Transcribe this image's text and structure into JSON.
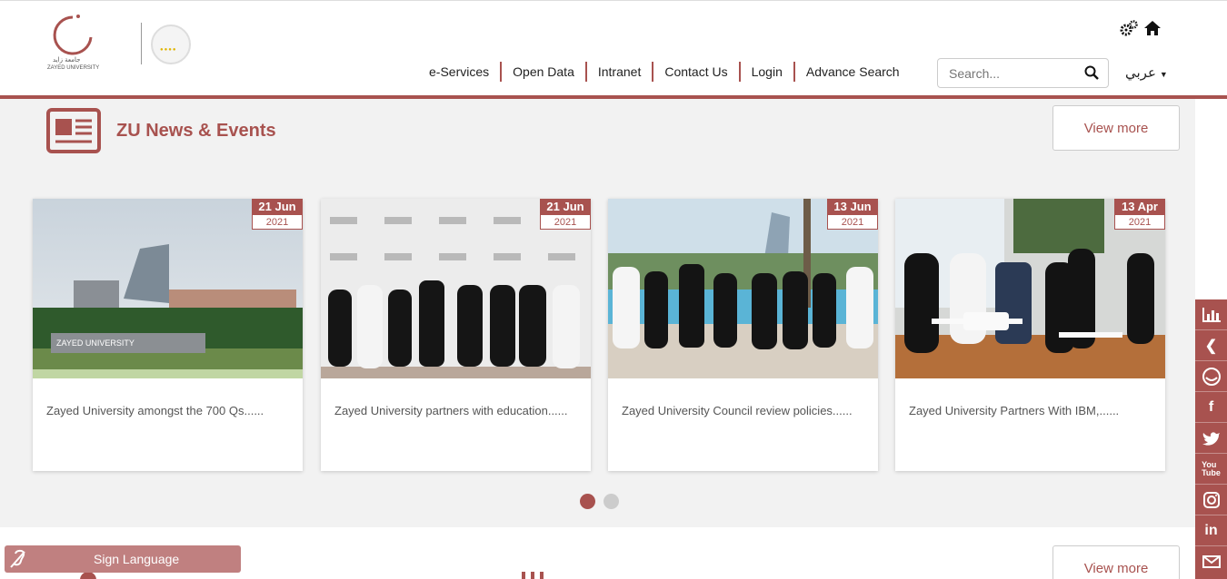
{
  "header": {
    "logo_text": "ZAYED UNIVERSITY",
    "nav": [
      "e-Services",
      "Open Data",
      "Intranet",
      "Contact Us",
      "Login",
      "Advance Search"
    ],
    "search_placeholder": "Search...",
    "language": "عربي"
  },
  "news": {
    "title": "ZU News & Events",
    "view_more": "View more",
    "cards": [
      {
        "day": "21 Jun",
        "year": "2021",
        "caption": "Zayed University amongst the 700 Qs......",
        "sign": "ZAYED UNIVERSITY"
      },
      {
        "day": "21 Jun",
        "year": "2021",
        "caption": "Zayed University partners with education......"
      },
      {
        "day": "13 Jun",
        "year": "2021",
        "caption": "Zayed University Council review policies......"
      },
      {
        "day": "13 Apr",
        "year": "2021",
        "caption": "Zayed University Partners With IBM,......"
      }
    ],
    "pagination": {
      "pages": 2,
      "active": 1
    }
  },
  "bottom": {
    "sign_language": "Sign Language",
    "view_more": "View more"
  },
  "social": [
    "stats-icon",
    "chevron-left-icon",
    "zu-icon",
    "facebook-icon",
    "twitter-icon",
    "youtube-icon",
    "instagram-icon",
    "linkedin-icon",
    "mail-icon"
  ],
  "colors": {
    "accent": "#a8524f",
    "section_bg": "#f2f2f2"
  }
}
